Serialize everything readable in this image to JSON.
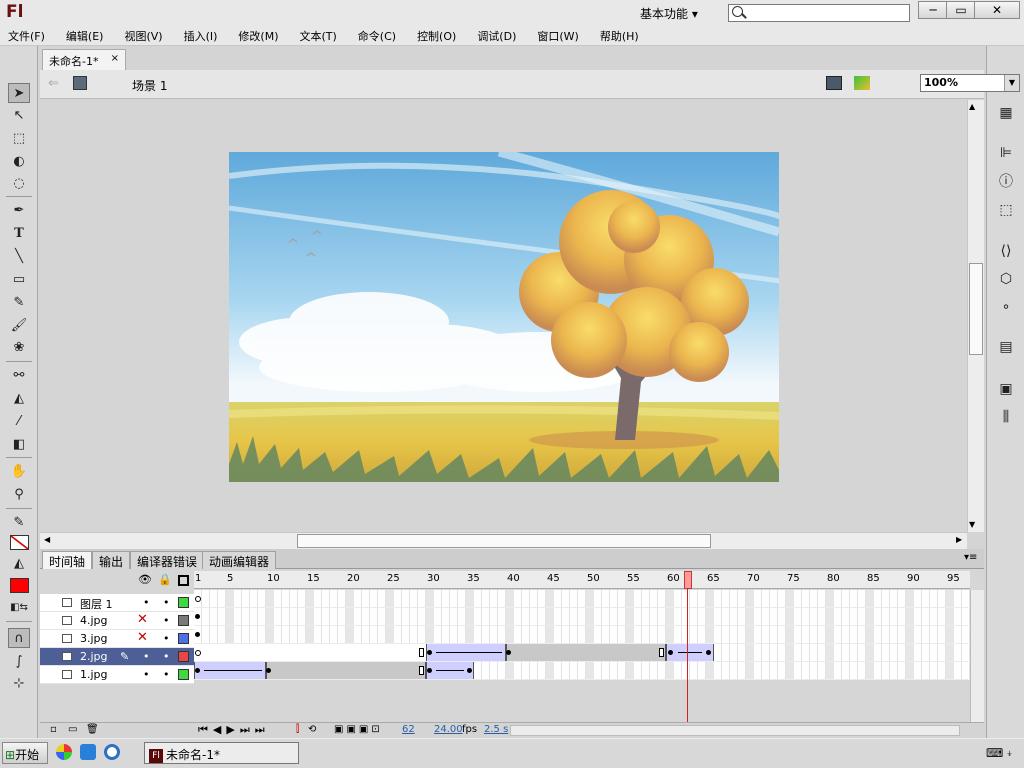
{
  "app": {
    "logo": "Fl",
    "workspace": "基本功能 ▾",
    "search_placeholder": ""
  },
  "window_buttons": [
    "─",
    "▭",
    "✕"
  ],
  "menu": [
    "文件(F)",
    "编辑(E)",
    "视图(V)",
    "插入(I)",
    "修改(M)",
    "文本(T)",
    "命令(C)",
    "控制(O)",
    "调试(D)",
    "窗口(W)",
    "帮助(H)"
  ],
  "document": {
    "tab": "未命名-1*",
    "close": "×",
    "scene": "场景 1",
    "zoom": "100%"
  },
  "timeline": {
    "tabs": [
      "时间轴",
      "输出",
      "编译器错误",
      "动画编辑器"
    ],
    "ruler_labels": [
      "1",
      "5",
      "10",
      "15",
      "20",
      "25",
      "30",
      "35",
      "40",
      "45",
      "50",
      "55",
      "60",
      "65",
      "70",
      "75",
      "80",
      "85",
      "90",
      "95"
    ],
    "layers": [
      {
        "name": "图层 1",
        "hidden": false,
        "color": "#3fd93f",
        "selected": false
      },
      {
        "name": "4.jpg",
        "hidden": true,
        "color": "#7a7a7a",
        "selected": false
      },
      {
        "name": "3.jpg",
        "hidden": true,
        "color": "#4f6fe6",
        "selected": false
      },
      {
        "name": "2.jpg",
        "hidden": false,
        "color": "#e84545",
        "selected": true
      },
      {
        "name": "1.jpg",
        "hidden": false,
        "color": "#3fd93f",
        "selected": false
      }
    ],
    "current_frame": "62",
    "fps": "24.00",
    "fps_unit": "fps",
    "time": "2.5 s"
  },
  "taskbar": {
    "start": "开始",
    "app": "未命名-1*",
    "app_icon": "Fl"
  }
}
